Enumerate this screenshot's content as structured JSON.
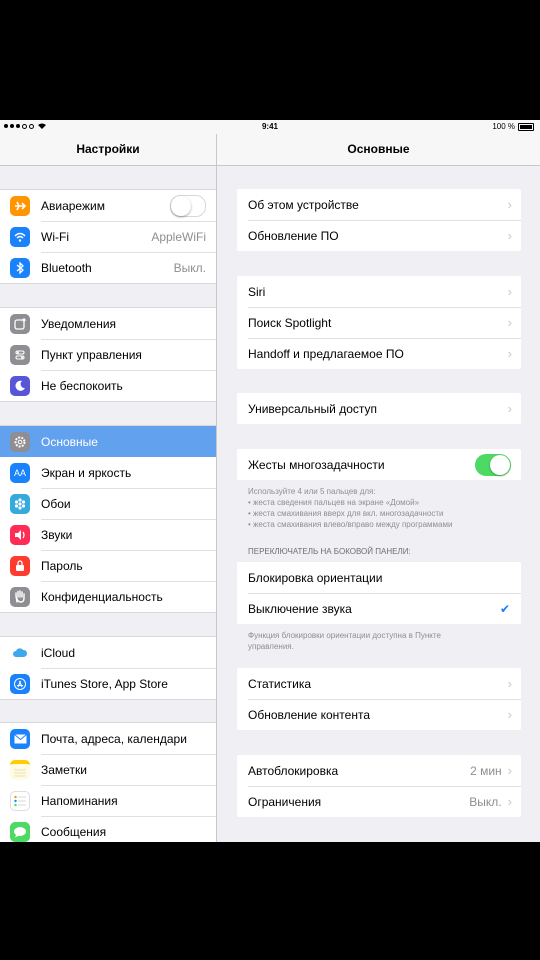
{
  "status": {
    "time": "9:41",
    "battery": "100 %"
  },
  "sidebar": {
    "title": "Настройки",
    "groups": [
      {
        "items": [
          {
            "label": "Авиарежим",
            "icon": "airplane-icon",
            "color": "#ff9500"
          },
          {
            "label": "Wi-Fi",
            "value": "AppleWiFi",
            "icon": "wifi-icon",
            "color": "#1a82fb"
          },
          {
            "label": "Bluetooth",
            "value": "Выкл.",
            "icon": "bluetooth-icon",
            "color": "#1a82fb"
          }
        ]
      },
      {
        "items": [
          {
            "label": "Уведомления",
            "icon": "notifications-icon",
            "color": "#8e8e93"
          },
          {
            "label": "Пункт управления",
            "icon": "control-center-icon",
            "color": "#8e8e93"
          },
          {
            "label": "Не беспокоить",
            "icon": "moon-icon",
            "color": "#5856d6"
          }
        ]
      },
      {
        "items": [
          {
            "label": "Основные",
            "icon": "gear-icon",
            "color": "#8e8e93",
            "selected": true
          },
          {
            "label": "Экран и яркость",
            "icon": "display-icon",
            "color": "#1a82fb"
          },
          {
            "label": "Обои",
            "icon": "wallpaper-icon",
            "color": "#35aadc"
          },
          {
            "label": "Звуки",
            "icon": "sounds-icon",
            "color": "#ff2d55"
          },
          {
            "label": "Пароль",
            "icon": "lock-icon",
            "color": "#ff3b30"
          },
          {
            "label": "Конфиденциальность",
            "icon": "hand-icon",
            "color": "#8e8e93"
          }
        ]
      },
      {
        "items": [
          {
            "label": "iCloud",
            "icon": "cloud-icon",
            "color": "#ffffff"
          },
          {
            "label": "iTunes Store, App Store",
            "icon": "appstore-icon",
            "color": "#1a82fb"
          }
        ]
      },
      {
        "items": [
          {
            "label": "Почта, адреса, календари",
            "icon": "mail-icon",
            "color": "#1a82fb"
          },
          {
            "label": "Заметки",
            "icon": "notes-icon",
            "color": "#ffcc00"
          },
          {
            "label": "Напоминания",
            "icon": "reminders-icon",
            "color": "#ffffff"
          },
          {
            "label": "Сообщения",
            "icon": "messages-icon",
            "color": "#4cd964"
          }
        ]
      }
    ]
  },
  "main": {
    "title": "Основные",
    "group1": [
      {
        "label": "Об этом устройстве"
      },
      {
        "label": "Обновление ПО"
      }
    ],
    "group2": [
      {
        "label": "Siri"
      },
      {
        "label": "Поиск Spotlight"
      },
      {
        "label": "Handoff и предлагаемое ПО"
      }
    ],
    "group3": [
      {
        "label": "Универсальный доступ"
      }
    ],
    "multitasking": {
      "label": "Жесты многозадачности",
      "note1": "Используйте 4 или 5 пальцев для:",
      "note2": "• жеста сведения пальцев на экране «Домой»",
      "note3": "• жеста смахивания вверх для вкл. многозадачности",
      "note4": "• жеста смахивания влево/вправо между программами"
    },
    "side_switch": {
      "header": "ПЕРЕКЛЮЧАТЕЛЬ НА БОКОВОЙ ПАНЕЛИ:",
      "option1": "Блокировка ориентации",
      "option2": "Выключение звука",
      "note1": "Функция блокировки ориентации доступна в Пункте",
      "note2": "управления."
    },
    "group5": [
      {
        "label": "Статистика"
      },
      {
        "label": "Обновление контента"
      }
    ],
    "group6": [
      {
        "label": "Автоблокировка",
        "value": "2 мин"
      },
      {
        "label": "Ограничения",
        "value": "Выкл."
      }
    ]
  }
}
